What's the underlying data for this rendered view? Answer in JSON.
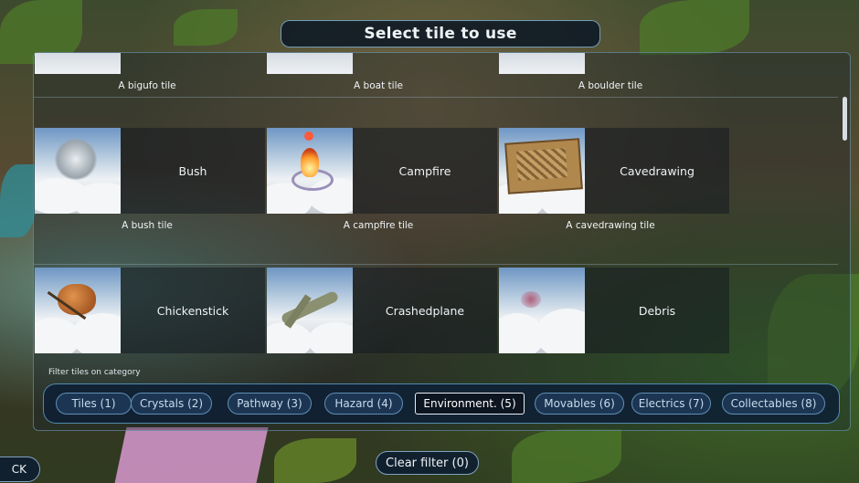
{
  "title": "Select tile to use",
  "partial_row": [
    {
      "description": "A bigufo tile"
    },
    {
      "description": "A boat tile"
    },
    {
      "description": "A boulder tile"
    }
  ],
  "tiles": [
    {
      "name": "Bush",
      "description": "A bush tile",
      "icon": "bush-thumbnail"
    },
    {
      "name": "Campfire",
      "description": "A campfire tile",
      "icon": "campfire-thumbnail"
    },
    {
      "name": "Cavedrawing",
      "description": "A cavedrawing tile",
      "icon": "cavedrawing-thumbnail"
    },
    {
      "name": "Chickenstick",
      "description": "",
      "icon": "chickenstick-thumbnail"
    },
    {
      "name": "Crashedplane",
      "description": "",
      "icon": "crashedplane-thumbnail"
    },
    {
      "name": "Debris",
      "description": "",
      "icon": "debris-thumbnail"
    }
  ],
  "filter": {
    "label": "Filter tiles on category",
    "categories": [
      {
        "label": "Tiles (1)"
      },
      {
        "label": "Crystals (2)"
      },
      {
        "label": "Pathway (3)"
      },
      {
        "label": "Hazard (4)"
      },
      {
        "label": "Environment.  (5)",
        "active": true
      },
      {
        "label": "Movables (6)"
      },
      {
        "label": "Electrics (7)"
      },
      {
        "label": "Collectables (8)"
      }
    ]
  },
  "clear_filter_label": "Clear filter (0)",
  "back_label": "CK",
  "colors": {
    "accent": "#5f8fb6",
    "panel": "#0e2034",
    "active_border": "#e8eef3"
  }
}
